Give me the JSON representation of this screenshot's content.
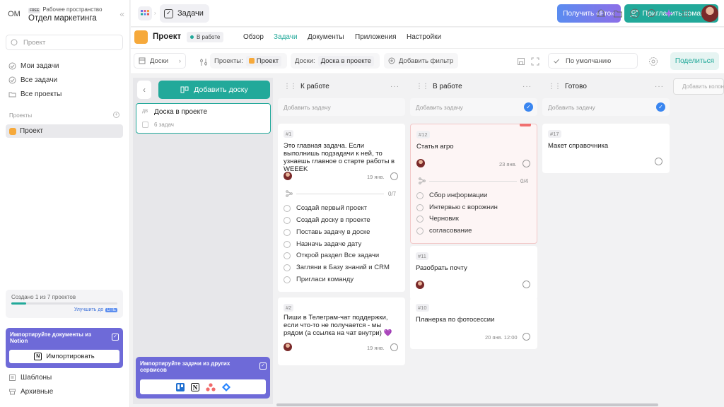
{
  "sidebar": {
    "workspace_avatar": "ОМ",
    "workspace_plan": "FREE",
    "workspace_sub": "Рабочее пространство",
    "workspace_name": "Отдел маркетинга",
    "search_placeholder": "Проект",
    "nav": [
      {
        "label": "Мои задачи",
        "icon": "check-circle-icon"
      },
      {
        "label": "Все задачи",
        "icon": "check-circle-icon"
      },
      {
        "label": "Все проекты",
        "icon": "folder-icon"
      }
    ],
    "projects_label": "Проекты",
    "project": "Проект",
    "quota_text": "Создано 1 из 7 проектов",
    "quota_fraction": 0.143,
    "upgrade_label": "Улучшить до",
    "upgrade_badge": "LITE",
    "notion_import_title": "Импортируйте документы из Notion",
    "notion_import_button": "Импортировать",
    "templates": "Шаблоны",
    "archive": "Архивные"
  },
  "topbar": {
    "breadcrumb": "Задачи",
    "pro_button": "Получить «Pro»",
    "invite_button": "Пригласить команду"
  },
  "project_bar": {
    "title": "Проект",
    "status": "В работе",
    "tabs": [
      "Обзор",
      "Задачи",
      "Документы",
      "Приложения",
      "Настройки"
    ],
    "active_tab": "Задачи"
  },
  "filters": {
    "boards_label": "Доски",
    "projects_label": "Проекты:",
    "projects_value": "Проект",
    "board_label": "Доски:",
    "board_value": "Доска в проекте",
    "add_filter": "Добавить фильтр",
    "sort": "По умолчанию",
    "share": "Поделиться"
  },
  "boards_panel": {
    "add_board": "Добавить доску",
    "board_name": "Доска в проекте",
    "board_count": "6 задач",
    "import_title": "Импортируйте задачи из других сервисов"
  },
  "columns": [
    {
      "title": "К работе",
      "add_task": "Добавить задачу",
      "cards": [
        {
          "id": "#1",
          "title": "Это главная задача. Если выполнишь подзадачи к ней, то узнаешь главное о старте работы в WEEEK",
          "date": "19 янв.",
          "progress": "0/7",
          "subtasks": [
            "Создай первый проект",
            "Создай доску в проекте",
            "Поставь задачу в доске",
            "Назначь задаче дату",
            "Открой раздел Все задачи",
            "Загляни в Базу знаний и CRM",
            "Пригласи команду"
          ]
        },
        {
          "id": "#2",
          "title": "Пиши в Телеграм-чат поддержки, если что-то не получается - мы рядом (а ссылка на чат внутри) 💜",
          "date": "19 янв."
        }
      ]
    },
    {
      "title": "В работе",
      "add_task": "Добавить задачу",
      "cards": [
        {
          "id": "#12",
          "title": "Статья агро",
          "date": "23 янв.",
          "progress": "0/4",
          "subtasks": [
            "Сбор информации",
            "Интервью с ворожнин",
            "Черновик",
            "согласование"
          ]
        },
        {
          "id": "#11",
          "title": "Разобрать почту"
        },
        {
          "id": "#10",
          "title": "Планерка по фотосессии",
          "date": "20 янв. 12:00"
        }
      ]
    },
    {
      "title": "Готово",
      "add_task": "Добавить задачу",
      "cards": [
        {
          "id": "#17",
          "title": "Макет справочника"
        }
      ]
    }
  ],
  "add_column": "Добавить колонку",
  "colors": {
    "accent": "#22a99a",
    "import_banner": "#6e6ad8",
    "project": "#f6a93b",
    "check": "#3a86f0"
  }
}
